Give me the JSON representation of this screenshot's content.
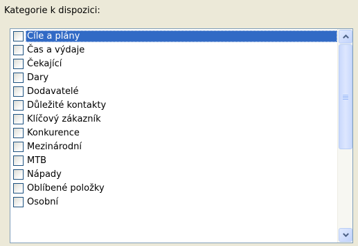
{
  "heading": "Kategorie k dispozici:",
  "selected_index": 0,
  "colors": {
    "selection": "#316ac5",
    "listbox_border": "#7f9db9",
    "dialog_background": "#ece9d8",
    "scroll_arrow": "#4d6185"
  },
  "icons": {
    "scroll_up": "chevron-up-icon",
    "scroll_down": "chevron-down-icon"
  },
  "categories": [
    {
      "label": "Cíle a plány",
      "checked": false
    },
    {
      "label": "Čas a výdaje",
      "checked": false
    },
    {
      "label": "Čekající",
      "checked": false
    },
    {
      "label": "Dary",
      "checked": false
    },
    {
      "label": "Dodavatelé",
      "checked": false
    },
    {
      "label": "Důležité kontakty",
      "checked": false
    },
    {
      "label": "Klíčový zákazník",
      "checked": false
    },
    {
      "label": "Konkurence",
      "checked": false
    },
    {
      "label": "Mezinárodní",
      "checked": false
    },
    {
      "label": "MTB",
      "checked": false
    },
    {
      "label": "Nápady",
      "checked": false
    },
    {
      "label": "Oblíbené položky",
      "checked": false
    },
    {
      "label": "Osobní",
      "checked": false
    }
  ]
}
